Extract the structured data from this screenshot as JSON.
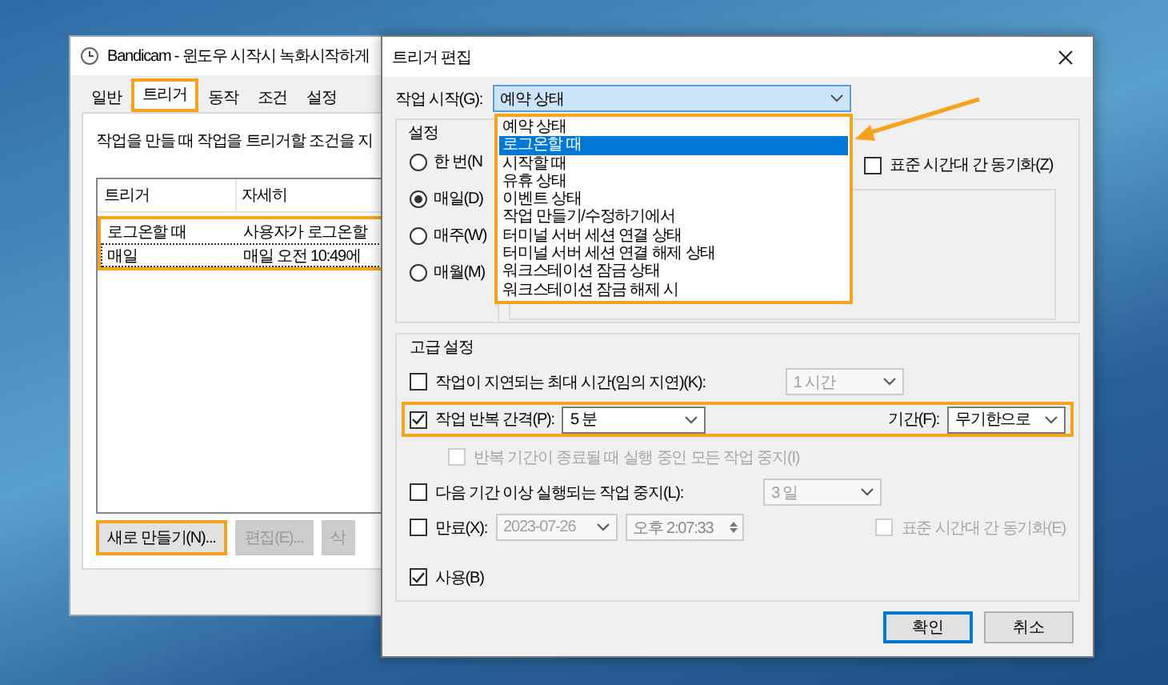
{
  "back_window": {
    "title": "Bandicam - 윈도우 시작시 녹화시작하게",
    "tabs": [
      {
        "label": "일반",
        "selected": false,
        "highlighted": false
      },
      {
        "label": "트리거",
        "selected": true,
        "highlighted": true
      },
      {
        "label": "동작",
        "selected": false,
        "highlighted": false
      },
      {
        "label": "조건",
        "selected": false,
        "highlighted": false
      },
      {
        "label": "설정",
        "selected": false,
        "highlighted": false
      }
    ],
    "description": "작업을 만들 때 작업을 트리거할 조건을 지",
    "trigger_list": {
      "columns": [
        "트리거",
        "자세히"
      ],
      "highlighted": true,
      "rows": [
        {
          "cells": [
            "로그온할 때",
            "사용자가 로그온할"
          ],
          "focused": false
        },
        {
          "cells": [
            "매일",
            "매일 오전 10:49에"
          ],
          "focused": true
        }
      ]
    },
    "buttons": [
      {
        "label": "새로 만들기(N)...",
        "disabled": false,
        "highlighted": true
      },
      {
        "label": "편집(E)...",
        "disabled": true,
        "highlighted": false
      },
      {
        "label": "삭",
        "disabled": true,
        "highlighted": false
      }
    ]
  },
  "dialog": {
    "title": "트리거 편집",
    "start_label": "작업 시작(G):",
    "start_value": "예약 상태",
    "dropdown": {
      "highlighted": true,
      "options": [
        {
          "label": "예약 상태",
          "selected": false
        },
        {
          "label": "로그온할 때",
          "selected": true
        },
        {
          "label": "시작할 때",
          "selected": false
        },
        {
          "label": "유휴 상태",
          "selected": false
        },
        {
          "label": "이벤트 상태",
          "selected": false
        },
        {
          "label": "작업 만들기/수정하기에서",
          "selected": false
        },
        {
          "label": "터미널 서버 세션 연결 상태",
          "selected": false
        },
        {
          "label": "터미널 서버 세션 연결 해제 상태",
          "selected": false
        },
        {
          "label": "워크스테이션 잠금 상태",
          "selected": false
        },
        {
          "label": "워크스테이션 잠금 해제 시",
          "selected": false
        }
      ]
    },
    "settings": {
      "title": "설정",
      "schedule": [
        {
          "label": "한 번(N",
          "selected": false
        },
        {
          "label": "매일(D)",
          "selected": true
        },
        {
          "label": "매주(W)",
          "selected": false
        },
        {
          "label": "매월(M)",
          "selected": false
        }
      ],
      "sync": {
        "label": "표준 시간대 간 동기화(Z)",
        "checked": false
      }
    },
    "advanced": {
      "title": "고급 설정",
      "rows": [
        {
          "kind": "check_combo",
          "label": "작업이 지연되는 최대 시간(임의 지연)(K):",
          "checked": false,
          "value": "1 시간",
          "disabled": true
        },
        {
          "kind": "repeat",
          "label": "작업 반복 간격(P):",
          "checked": true,
          "value": "5 분",
          "duration_label": "기간(F):",
          "duration_value": "무기한으로",
          "highlighted": true
        },
        {
          "kind": "sub_check",
          "label": "반복 기간이 종료될 때 실행 중인 모든 작업 중지(I)",
          "checked": false,
          "disabled": true
        },
        {
          "kind": "check_combo",
          "label": "다음 기간 이상 실행되는 작업 중지(L):",
          "checked": false,
          "value": "3 일",
          "disabled": true
        },
        {
          "kind": "expire",
          "label": "만료(X):",
          "checked": false,
          "date": "2023-07-26",
          "ampm": "오후",
          "time": "2:07:33",
          "sync_label": "표준 시간대 간 동기화(E)",
          "sync_checked": false
        },
        {
          "kind": "check",
          "label": "사용(B)",
          "checked": true
        }
      ]
    },
    "buttons": [
      {
        "label": "확인",
        "default": true
      },
      {
        "label": "취소",
        "default": false
      }
    ]
  }
}
